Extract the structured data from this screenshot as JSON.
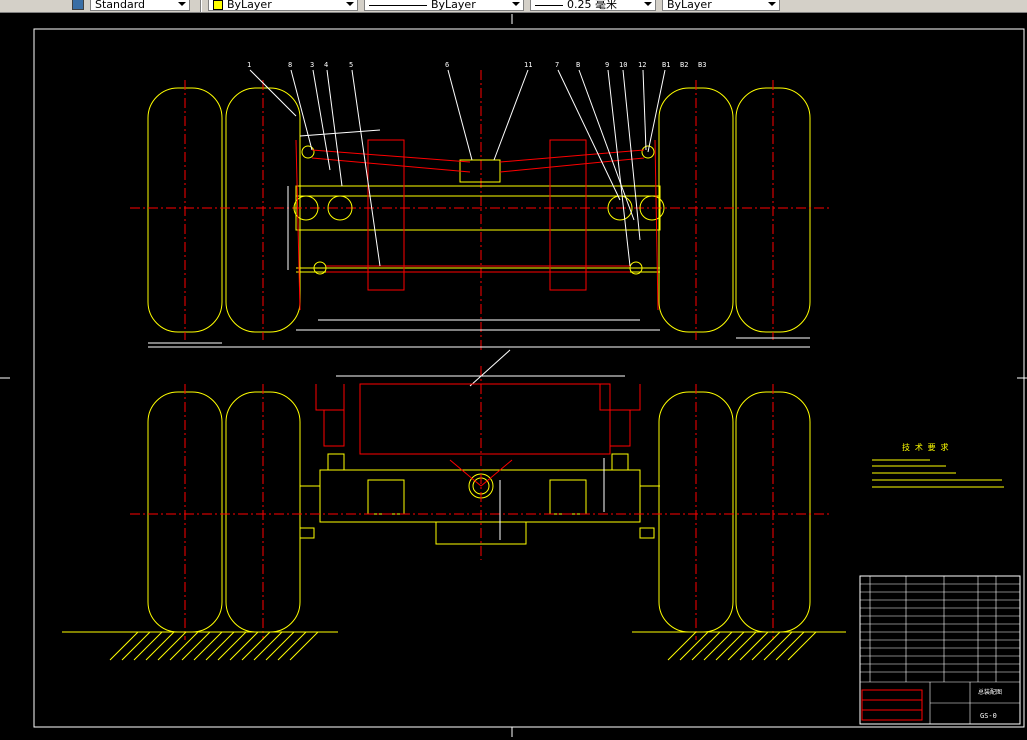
{
  "toolbar": {
    "text_style": "Standard",
    "color": "ByLayer",
    "linetype": "ByLayer",
    "lineweight": "0.25 毫米",
    "plot_style": "ByLayer"
  },
  "drawing": {
    "part_labels": [
      "1",
      "8",
      "3",
      "4",
      "5",
      "6",
      "11",
      "7",
      "B",
      "9",
      "10",
      "12",
      "B1",
      "B2",
      "B3"
    ],
    "tech_title": "技 术 要 求",
    "title_block_name": "总装配图",
    "drawing_no": "GS-0"
  },
  "colors": {
    "background": "#000000",
    "frame": "#ffffff",
    "outline": "#ffff00",
    "center": "#ff0000",
    "dim": "#ffffff"
  }
}
